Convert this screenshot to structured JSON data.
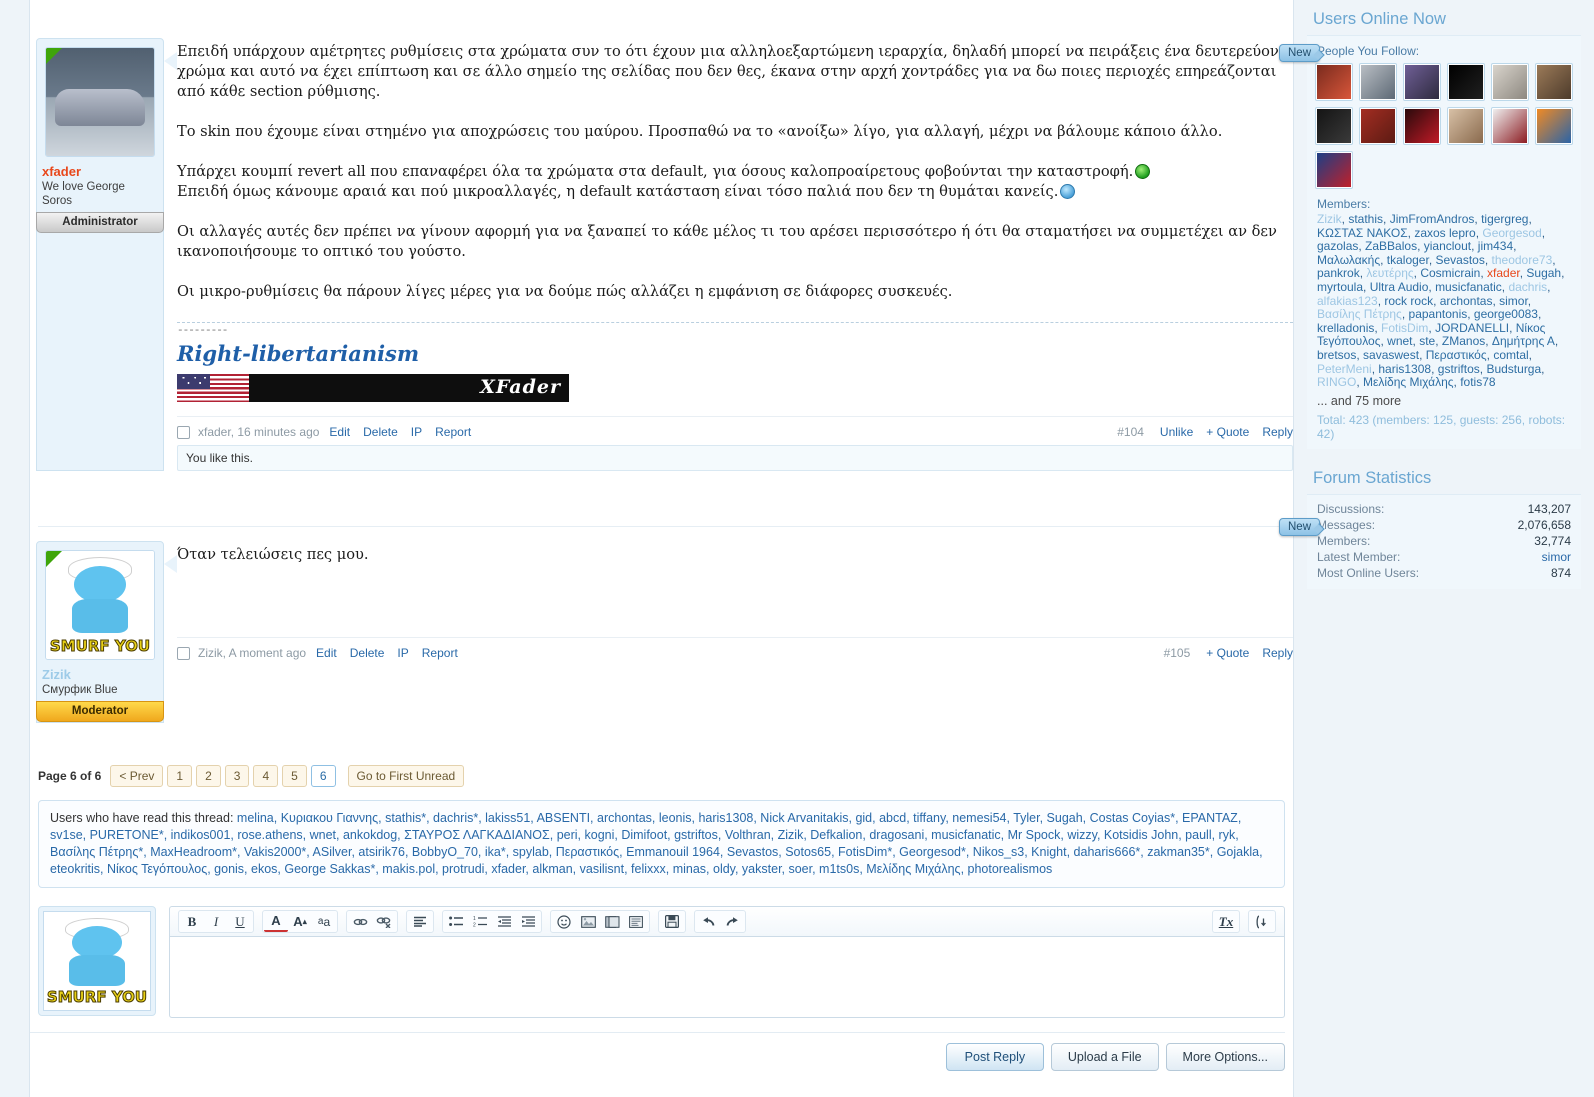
{
  "posts": [
    {
      "username": "xfader",
      "usertitle": "We love George Soros",
      "rank": "Administrator",
      "avatar_alt": "muscle-car-artwork",
      "paragraphs": [
        "Επειδή υπάρχουν αμέτρητες ρυθμίσεις στα χρώματα συν το ότι έχουν μια αλληλοεξαρτώμενη ιεραρχία, δηλαδή μπορεί να πειράξεις ένα δευτερεύον χρώμα και αυτό να έχει επίπτωση και σε άλλο σημείο της σελίδας που δεν θες, έκανα στην αρχή χοντράδες για να δω ποιες περιοχές επηρεάζονται από κάθε section ρύθμισης.",
        "Το skin που έχουμε είναι στημένο για αποχρώσεις του μαύρου. Προσπαθώ να το «ανοίξω» λίγο, για αλλαγή, μέχρι να βάλουμε κάποιο άλλο.",
        "Υπάρχει κουμπί revert all που επαναφέρει όλα τα χρώματα στα default, για όσους καλοπροαίρετους φοβούνται την καταστροφή.",
        "Επειδή όμως κάνουμε αραιά και πού μικροαλλαγές, η default κατάσταση είναι τόσο παλιά που δεν τη θυμάται κανείς.",
        "Οι αλλαγές αυτές δεν πρέπει να γίνουν αφορμή για να ξαναπεί το κάθε μέλος τι του αρέσει περισσότερο ή ότι θα σταματήσει να συμμετέχει αν δεν ικανοποιήσουμε το οπτικό του γούστο.",
        "Οι μικρο-ρυθμίσεις θα πάρουν λίγες μέρες για να δούμε πώς αλλάζει η εμφάνιση σε διάφορες συσκευές."
      ],
      "signature": {
        "dashes": "---------",
        "title": "Right-libertarianism",
        "banner_text": "XFader"
      },
      "footer": {
        "byline": "xfader, 16 minutes ago",
        "edit": "Edit",
        "delete": "Delete",
        "ip": "IP",
        "report": "Report",
        "post_number": "#104",
        "like": "Unlike",
        "quote": "+ Quote",
        "reply": "Reply"
      },
      "like_notice": "You like this."
    },
    {
      "username": "Zizik",
      "usertitle": "Смурфик Blue",
      "rank": "Moderator",
      "avatar_alt": "smurf-you-artwork",
      "paragraphs": [
        "Όταν τελειώσεις πες μου."
      ],
      "footer": {
        "byline": "Zizik, A moment ago",
        "edit": "Edit",
        "delete": "Delete",
        "ip": "IP",
        "report": "Report",
        "post_number": "#105",
        "quote": "+ Quote",
        "reply": "Reply"
      }
    }
  ],
  "pagination": {
    "label": "Page 6 of 6",
    "prev": "< Prev",
    "pages": [
      "1",
      "2",
      "3",
      "4",
      "5",
      "6"
    ],
    "current": "6",
    "first_unread": "Go to First Unread"
  },
  "readers": {
    "lead": "Users who have read this thread:",
    "names": "melina, Κυριακου Γιαννης, stathis*, dachris*, lakiss51, ABSENTI, archontas, leonis, haris1308, Nick Arvanitakis, gid, abcd, tiffany, nemesi54, Tyler, Sugah, Costas Coyias*, ΕΡΑΝΤΑΖ, sv1se, PURETONE*, indikos001, rose.athens, wnet, ankokdog, ΣΤΑΥΡΟΣ ΛΑΓΚΑΔΙΑΝΟΣ, peri, kogni, Dimifoot, gstriftos, Volthran, Zizik, Defkalion, dragosani, musicfanatic, Mr Spock, wizzy, Kotsidis John, paull, ryk, Βασίλης Πέτρης*, MaxHeadroom*, Vakis2000*, ASilver, atsirik76, BobbyO_70, ika*, spylab, Περαστικός, Emmanouil 1964, Sevastos, Sotos65, FotisDim*, Georgesod*, Nikos_s3, Knight, daharis666*, zakman35*, Gojakla, eteokritis, Νίκος Τεγόπουλος, gonis, ekos, George Sakkas*, makis.pol, protrudi, xfader, alkman, vasilisnt, felixxx, minas, oldy, yakster, soer, m1ts0s, Μελίδης Μιχάλης, photorealismos"
  },
  "editor": {
    "tools": [
      {
        "name": "bold-button",
        "glyph": "B"
      },
      {
        "name": "italic-button",
        "glyph": "I"
      },
      {
        "name": "underline-button",
        "glyph": "U"
      },
      {
        "name": "text-color-button",
        "glyph": "A"
      },
      {
        "name": "font-size-button",
        "glyph": "A"
      },
      {
        "name": "font-family-button",
        "glyph": "a"
      },
      {
        "name": "insert-link-button",
        "glyph": "link"
      },
      {
        "name": "remove-link-button",
        "glyph": "unlink"
      },
      {
        "name": "align-button",
        "glyph": "align"
      },
      {
        "name": "bullet-list-button",
        "glyph": "ul"
      },
      {
        "name": "numbered-list-button",
        "glyph": "ol"
      },
      {
        "name": "outdent-button",
        "glyph": "outdent"
      },
      {
        "name": "indent-button",
        "glyph": "indent"
      },
      {
        "name": "smilies-button",
        "glyph": "smiley"
      },
      {
        "name": "insert-image-button",
        "glyph": "image"
      },
      {
        "name": "insert-media-button",
        "glyph": "media"
      },
      {
        "name": "insert-quote-button",
        "glyph": "quote"
      },
      {
        "name": "draft-save-button",
        "glyph": "save"
      },
      {
        "name": "undo-button",
        "glyph": "undo"
      },
      {
        "name": "redo-button",
        "glyph": "redo"
      },
      {
        "name": "remove-formatting-button",
        "glyph": "Tx"
      },
      {
        "name": "toggle-bbcode-button",
        "glyph": "source"
      }
    ],
    "textarea_placeholder": ""
  },
  "actions": {
    "post_reply": "Post Reply",
    "upload_file": "Upload a File",
    "more_options": "More Options..."
  },
  "sidebar": {
    "online": {
      "title": "Users Online Now",
      "follow_label": "People You Follow:",
      "avatars": [
        {
          "name": "avatar-spiderman",
          "color1": "#7a2b1e",
          "color2": "#d8563a"
        },
        {
          "name": "avatar-cat",
          "color1": "#b9bec4",
          "color2": "#5d6975"
        },
        {
          "name": "avatar-purple-car",
          "color1": "#6f5f96",
          "color2": "#2e2a3e"
        },
        {
          "name": "avatar-eye-logo",
          "color1": "#000000",
          "color2": "#202020"
        },
        {
          "name": "avatar-banksy",
          "color1": "#d9d4cc",
          "color2": "#8d8880"
        },
        {
          "name": "avatar-room",
          "color1": "#9b7a58",
          "color2": "#4d3b2b"
        },
        {
          "name": "avatar-dark-hands",
          "color1": "#141414",
          "color2": "#3a3a3a"
        },
        {
          "name": "avatar-war-poster",
          "color1": "#a32d22",
          "color2": "#5c1b13"
        },
        {
          "name": "avatar-red-mic",
          "color1": "#2a0a0c",
          "color2": "#c01a26"
        },
        {
          "name": "avatar-portrait",
          "color1": "#d7c0a6",
          "color2": "#8a6a4d"
        },
        {
          "name": "avatar-rose",
          "color1": "#efefef",
          "color2": "#8c1c22"
        },
        {
          "name": "avatar-firefox",
          "color1": "#f08a24",
          "color2": "#2a64a8"
        },
        {
          "name": "avatar-abstract-blue",
          "color1": "#1c3f86",
          "color2": "#c0202a"
        }
      ],
      "members_label": "Members:",
      "members": [
        {
          "n": "Zizik",
          "c": "dim"
        },
        {
          "n": "stathis",
          "c": "m"
        },
        {
          "n": "JimFromAndros",
          "c": "m"
        },
        {
          "n": "tigergreg",
          "c": "m"
        },
        {
          "n": "ΚΩΣΤΑΣ ΝΑΚΟΣ",
          "c": "m"
        },
        {
          "n": "zaxos lepro",
          "c": "m"
        },
        {
          "n": "Georgesod",
          "c": "dim"
        },
        {
          "n": "gazolas",
          "c": "m"
        },
        {
          "n": "ZaBBalos",
          "c": "m"
        },
        {
          "n": "yianclout",
          "c": "m"
        },
        {
          "n": "jim434",
          "c": "m"
        },
        {
          "n": "Μαλωλακής",
          "c": "m"
        },
        {
          "n": "tkaloger",
          "c": "m"
        },
        {
          "n": "Sevastos",
          "c": "m"
        },
        {
          "n": "theodore73",
          "c": "dim"
        },
        {
          "n": "pankrok",
          "c": "m"
        },
        {
          "n": "λευτέρης",
          "c": "dim"
        },
        {
          "n": "Cosmicrain",
          "c": "m"
        },
        {
          "n": "xfader",
          "c": "red"
        },
        {
          "n": "Sugah",
          "c": "m"
        },
        {
          "n": "myrtoula",
          "c": "m"
        },
        {
          "n": "Ultra Audio",
          "c": "m"
        },
        {
          "n": "musicfanatic",
          "c": "m"
        },
        {
          "n": "dachris",
          "c": "dim"
        },
        {
          "n": "alfakias123",
          "c": "dim"
        },
        {
          "n": "rock rock",
          "c": "m"
        },
        {
          "n": "archontas",
          "c": "m"
        },
        {
          "n": "simor",
          "c": "m"
        },
        {
          "n": "Βασίλης Πέτρης",
          "c": "dim"
        },
        {
          "n": "papantonis",
          "c": "m"
        },
        {
          "n": "george0083",
          "c": "m"
        },
        {
          "n": "krelladonis",
          "c": "m"
        },
        {
          "n": "FotisDim",
          "c": "dim"
        },
        {
          "n": "JORDANELLI",
          "c": "m"
        },
        {
          "n": "Νίκος Τεγόπουλος",
          "c": "m"
        },
        {
          "n": "wnet",
          "c": "m"
        },
        {
          "n": "ste",
          "c": "m"
        },
        {
          "n": "ZManos",
          "c": "m"
        },
        {
          "n": "Δημήτρης Α",
          "c": "m"
        },
        {
          "n": "bretsos",
          "c": "m"
        },
        {
          "n": "savaswest",
          "c": "m"
        },
        {
          "n": "Περαστικός",
          "c": "m"
        },
        {
          "n": "comtal",
          "c": "m"
        },
        {
          "n": "PeterMeni",
          "c": "dim"
        },
        {
          "n": "haris1308",
          "c": "m"
        },
        {
          "n": "gstriftos",
          "c": "m"
        },
        {
          "n": "Budsturga",
          "c": "m"
        },
        {
          "n": "RINGO",
          "c": "dim"
        },
        {
          "n": "Μελίδης Μιχάλης",
          "c": "m"
        },
        {
          "n": "fotis78",
          "c": "m"
        }
      ],
      "more": "... and 75 more",
      "total": "Total: 423 (members: 125, guests: 256, robots: 42)"
    },
    "statistics": {
      "title": "Forum Statistics",
      "rows": [
        {
          "key": "Discussions:",
          "value": "143,207",
          "link": false
        },
        {
          "key": "Messages:",
          "value": "2,076,658",
          "link": false
        },
        {
          "key": "Members:",
          "value": "32,774",
          "link": false
        },
        {
          "key": "Latest Member:",
          "value": "simor",
          "link": true
        },
        {
          "key": "Most Online Users:",
          "value": "874",
          "link": false
        }
      ]
    }
  },
  "badges": {
    "new": "New"
  }
}
